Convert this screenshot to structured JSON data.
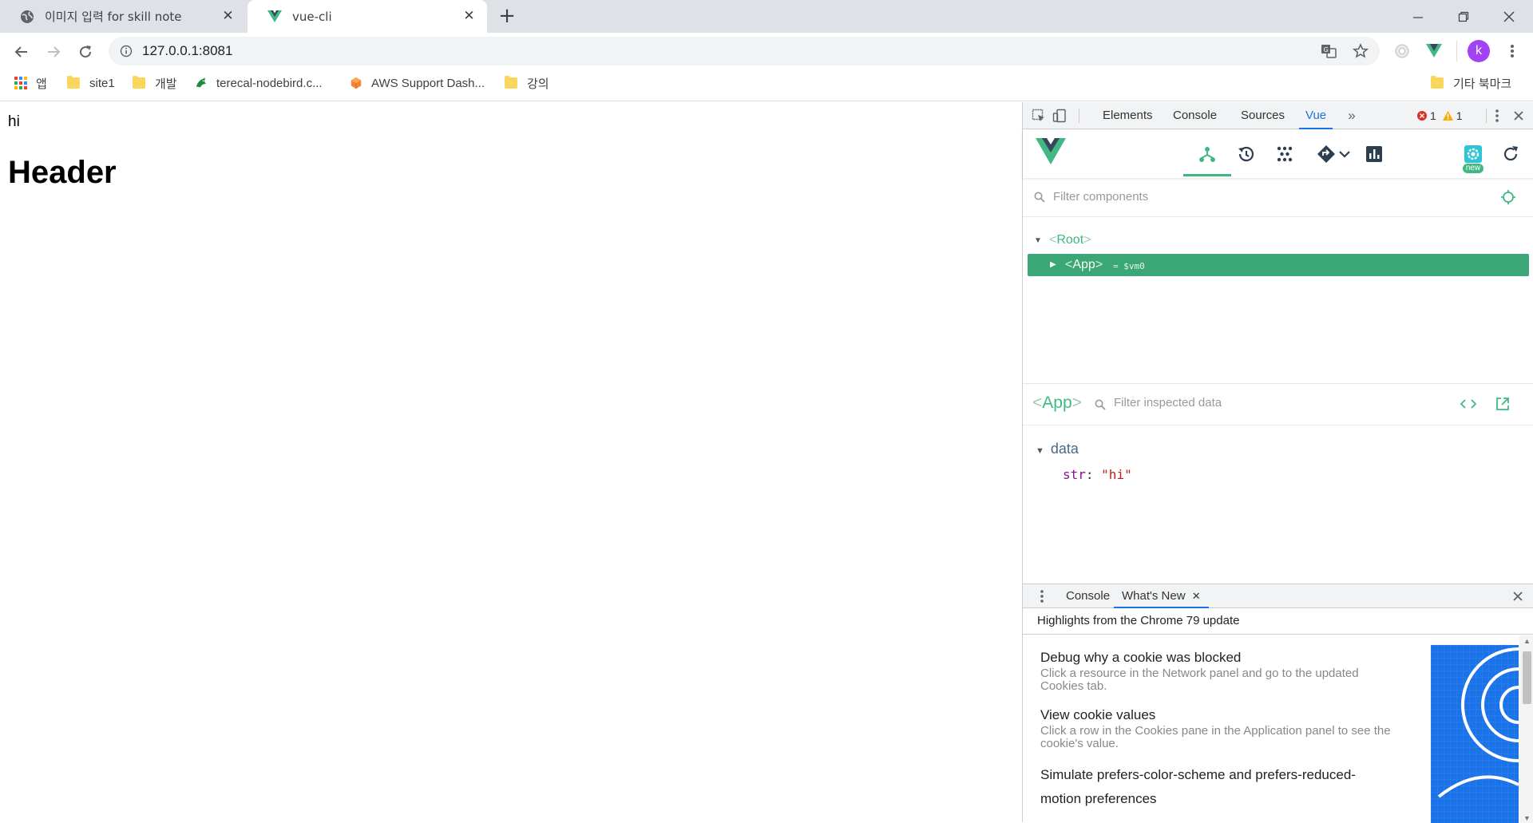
{
  "browser": {
    "tabs": [
      {
        "title": "이미지 입력 for skill note",
        "active": false,
        "favicon": "globe-icon"
      },
      {
        "title": "vue-cli",
        "active": true,
        "favicon": "vue-logo-icon"
      }
    ],
    "url": "127.0.0.1:8081",
    "profile_initial": "k",
    "accent_color": "#41b883",
    "bookmarks": [
      {
        "label": "앱",
        "icon": "apps-grid-icon"
      },
      {
        "label": "site1",
        "icon": "folder-icon"
      },
      {
        "label": "개발",
        "icon": "folder-icon"
      },
      {
        "label": "terecal-nodebird.c...",
        "icon": "bird-icon"
      },
      {
        "label": "AWS Support Dash...",
        "icon": "aws-cube-icon"
      },
      {
        "label": "강의",
        "icon": "folder-icon"
      }
    ],
    "other_bookmarks": "기타 북마크"
  },
  "page": {
    "text": "hi",
    "heading": "Header"
  },
  "devtools": {
    "tabs": [
      "Elements",
      "Console",
      "Sources",
      "Vue"
    ],
    "active_tab": "Vue",
    "error_count": "1",
    "warning_count": "1",
    "vue": {
      "filter_components_placeholder": "Filter components",
      "root_label": "Root",
      "app_label": "App",
      "app_vm": "= $vm0",
      "new_badge": "new",
      "inspected_component": "App",
      "filter_data_placeholder": "Filter inspected data",
      "data_section": "data",
      "data_key": "str",
      "data_value": "\"hi\""
    },
    "drawer": {
      "tabs": [
        "Console",
        "What's New"
      ],
      "active_tab": "What's New",
      "highlights": "Highlights from the Chrome 79 update",
      "items": [
        {
          "title": "Debug why a cookie was blocked",
          "desc": "Click a resource in the Network panel and go to the updated Cookies tab."
        },
        {
          "title": "View cookie values",
          "desc": "Click a row in the Cookies pane in the Application panel to see the cookie's value."
        },
        {
          "title": "Simulate prefers-color-scheme and prefers-reduced-motion preferences",
          "desc": ""
        }
      ]
    }
  }
}
